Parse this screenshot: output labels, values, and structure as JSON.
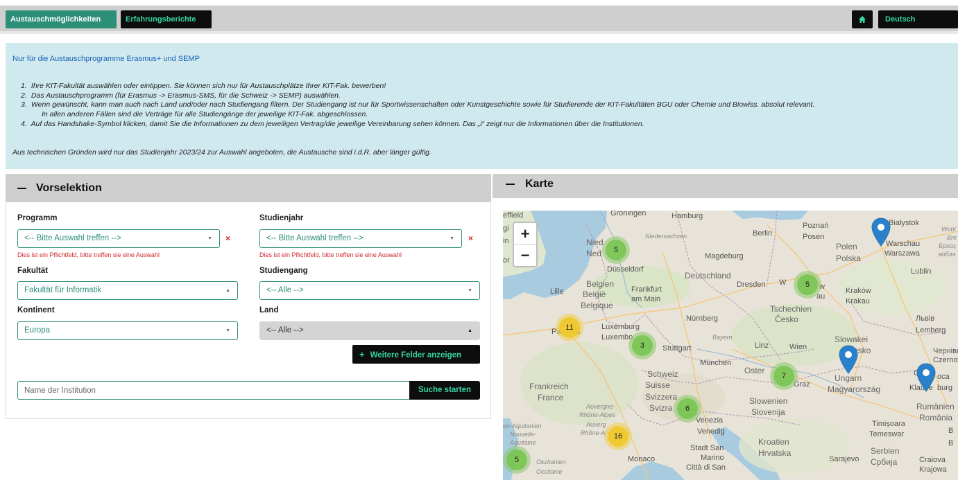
{
  "nav": {
    "tab_exchange": "Austauschmöglichkeiten",
    "tab_reports": "Erfahrungsberichte",
    "home_icon": "home-icon",
    "language": "Deutsch"
  },
  "info": {
    "heading": "Nur für die Austauschprogramme Erasmus+ und SEMP",
    "steps": [
      {
        "num": "1.",
        "text": "Ihre KIT-Fakultät auswählen oder eintippen. Sie können sich nur für Austauschplätze Ihrer KIT-Fak. bewerben!"
      },
      {
        "num": "2.",
        "text": "Das Austauschprogramm (für Erasmus -> Erasmus-SMS, für die Schweiz -> SEMP) auswählen."
      },
      {
        "num": "3.",
        "text": "Wenn gewünscht, kann man auch nach Land und/oder nach Studiengang filtern. Der Studiengang ist nur für Sportwissenschaften oder Kunstgeschichte sowie für Studierende der KIT-Fakultäten BGU oder Chemie und Biowiss.  absolut relevant.",
        "continuation": "In allen anderen Fällen sind die Verträge für alle Studiengänge der jeweilige KIT-Fak. abgeschlossen."
      },
      {
        "num": "4.",
        "text": "Auf das Handshake-Symbol klicken, damit Sie die Informationen zu dem jeweiligen Vertrag/die jeweilige Vereinbarung sehen können. Das „i“ zeigt nur die Informationen über die Institutionen."
      }
    ],
    "footer": "Aus technischen Gründen wird nur das Studienjahr 2023/24 zur Auswahl angeboten, die Austausche sind i.d.R. aber länger gültig."
  },
  "preselection": {
    "title": "Vorselektion",
    "programm_label": "Programm",
    "programm_value": "<-- Bitte Auswahl treffen -->",
    "studienjahr_label": "Studienjahr",
    "studienjahr_value": "<-- Bitte Auswahl treffen -->",
    "required_error": "Dies ist ein Pflichtfeld, bitte treffen sie eine Auswahl",
    "fakultaet_label": "Fakultät",
    "fakultaet_value": "Fakultät für Informatik",
    "studiengang_label": "Studiengang",
    "studiengang_value": "<-- Alle -->",
    "kontinent_label": "Kontinent",
    "kontinent_value": "Europa",
    "land_label": "Land",
    "land_value": "<-- Alle -->",
    "more_fields": "Weitere Felder anzeigen",
    "institution_placeholder": "Name der Institution",
    "search": "Suche starten",
    "clear_symbol": "×"
  },
  "map": {
    "title": "Karte",
    "zoom_in": "+",
    "zoom_out": "−",
    "clusters": [
      "5",
      "5",
      "11",
      "3",
      "7",
      "6",
      "16",
      "5"
    ],
    "labels": {
      "effield": "effield",
      "groningen": "Groningen",
      "hamburg": "Hamburg",
      "niedersachsen": "Niedersachsen",
      "berlin": "Berlin",
      "poznan": "Poznań",
      "posen": "Posen",
      "bialystok": "Białystok",
      "neder_a": "Nied",
      "neder_b": "Ned",
      "polen": "Polen",
      "polska": "Polska",
      "warschau": "Warschau",
      "warszawa": "Warszawa",
      "magdeburg": "Magdeburg",
      "dusseldorf": "Düsseldorf",
      "deutschland": "Deutschland",
      "belgien": "Belgien",
      "belgie": "België",
      "belgique": "Belgique",
      "lille": "Lille",
      "frankfurt": "Frankfurt",
      "am_main": "am Main",
      "dresden": "Dresden",
      "wroclaw_a": "W",
      "wroclaw_b": "w",
      "breslau_tail": "au",
      "krakow": "Kraków",
      "krakau": "Krakau",
      "lublin": "Lublin",
      "tschechien": "Tschechien",
      "cesko": "Česko",
      "nurnberg": "Nürnberg",
      "luxemburg": "Luxemburg",
      "luxembourg": "Luxembo",
      "bayern": "Bayern",
      "stuttgart": "Stuttgart",
      "linz": "Linz",
      "wien": "Wien",
      "slowakei": "Slowakei",
      "slovensko": "nsko",
      "lviv": "Львів",
      "lemberg": "Lemberg",
      "chernivtsi": "Чернівц",
      "czernowitz": "Czernowit",
      "munchen": "München",
      "oster": "Oster",
      "graz": "Graz",
      "ungarn": "Ungarn",
      "magyarorszag": "Magyarország",
      "cluj": "Cluj",
      "klausenburg": "Klause",
      "burg": "burg",
      "oca": "oca",
      "schweiz": "Schweiz",
      "suisse": "Suisse",
      "svizzera": "Svizzera",
      "svizra": "Svizra",
      "frankreich": "Frankreich",
      "france": "France",
      "slowenien": "Slowenien",
      "slovenija": "Slovenija",
      "rumanien": "Rumänien",
      "romania": "România",
      "venezia": "Venezia",
      "venedig": "Venedig",
      "timisoara": "Timișoara",
      "temeswar": "Temeswar",
      "auvergne": "Auvergne-",
      "rhone_alpes": "Rhône-Alpes",
      "auvergne2": "Auverg",
      "rhone_alpes2": "Rhône-Al",
      "aquitanien": "eu-Aquitanien",
      "nouvelle": "Nouvelle-",
      "aquitaine": "Aquitaine",
      "kroatien": "Kroatien",
      "hrvatska": "Hrvatska",
      "serbien": "Serbien",
      "srbija": "Србија",
      "stadt_san": "Stadt San",
      "marino": "Marino",
      "citta": "Città di San",
      "monaco": "Monaco",
      "okzitanien": "Okzitanien",
      "occitanie": "Occitanie",
      "sarajevo": "Sarajevo",
      "craiova": "Craiova",
      "krajowa": "Krajowa",
      "paris_a": "Pa",
      "paris_b": "s",
      "wobl": "Wobl",
      "bre": "Bre",
      "brest": "Брэсц",
      "vobl": "вобла",
      "gi": "gi",
      "in": "in",
      "or": "or",
      "b1": "B",
      "b2": "B"
    }
  }
}
